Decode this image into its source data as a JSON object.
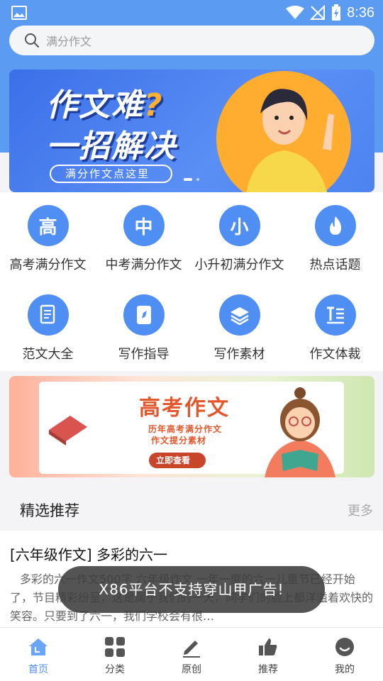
{
  "status_bar": {
    "time": "8:36"
  },
  "search": {
    "placeholder": "满分作文"
  },
  "banner": {
    "title_line1": "作文难",
    "title_q": "?",
    "title_line2": "一招解决",
    "pill": "满分作文点这里"
  },
  "categories": [
    {
      "glyph": "高",
      "label": "高考满分作文",
      "icon": "gao-icon"
    },
    {
      "glyph": "中",
      "label": "中考满分作文",
      "icon": "zhong-icon"
    },
    {
      "glyph": "小",
      "label": "小升初满分作文",
      "icon": "xiao-icon"
    },
    {
      "glyph": "",
      "label": "热点话题",
      "icon": "fire-icon"
    },
    {
      "glyph": "",
      "label": "范文大全",
      "icon": "document-icon"
    },
    {
      "glyph": "",
      "label": "写作指导",
      "icon": "compass-book-icon"
    },
    {
      "glyph": "",
      "label": "写作素材",
      "icon": "layers-icon"
    },
    {
      "glyph": "",
      "label": "作文体裁",
      "icon": "text-format-icon"
    }
  ],
  "promo": {
    "title": "高考作文",
    "sub1": "历年高考满分作文",
    "sub2": "作文提分素材",
    "button": "立即查看"
  },
  "section": {
    "title": "精选推荐",
    "more": "更多"
  },
  "article": {
    "title": "[六年级作文] 多彩的六一",
    "body": "多彩的六一作文500字 六年级作文 一年一度的六一儿童节已经开始了，节目精彩纷呈，这是属于我们的一天，同学们的脸上都洋溢着欢快的笑容。只要到了六一，我们学校会有很…"
  },
  "toast": "X86平台不支持穿山甲广告!",
  "bottom_nav": [
    {
      "label": "首页",
      "icon": "home-icon",
      "active": true
    },
    {
      "label": "分类",
      "icon": "grid-icon",
      "active": false
    },
    {
      "label": "原创",
      "icon": "pen-icon",
      "active": false
    },
    {
      "label": "推荐",
      "icon": "thumb-up-icon",
      "active": false
    },
    {
      "label": "我的",
      "icon": "smile-icon",
      "active": false
    }
  ],
  "colors": {
    "primary": "#4f8ff3",
    "header": "#5b9cf2",
    "promo_accent": "#e2572b"
  }
}
